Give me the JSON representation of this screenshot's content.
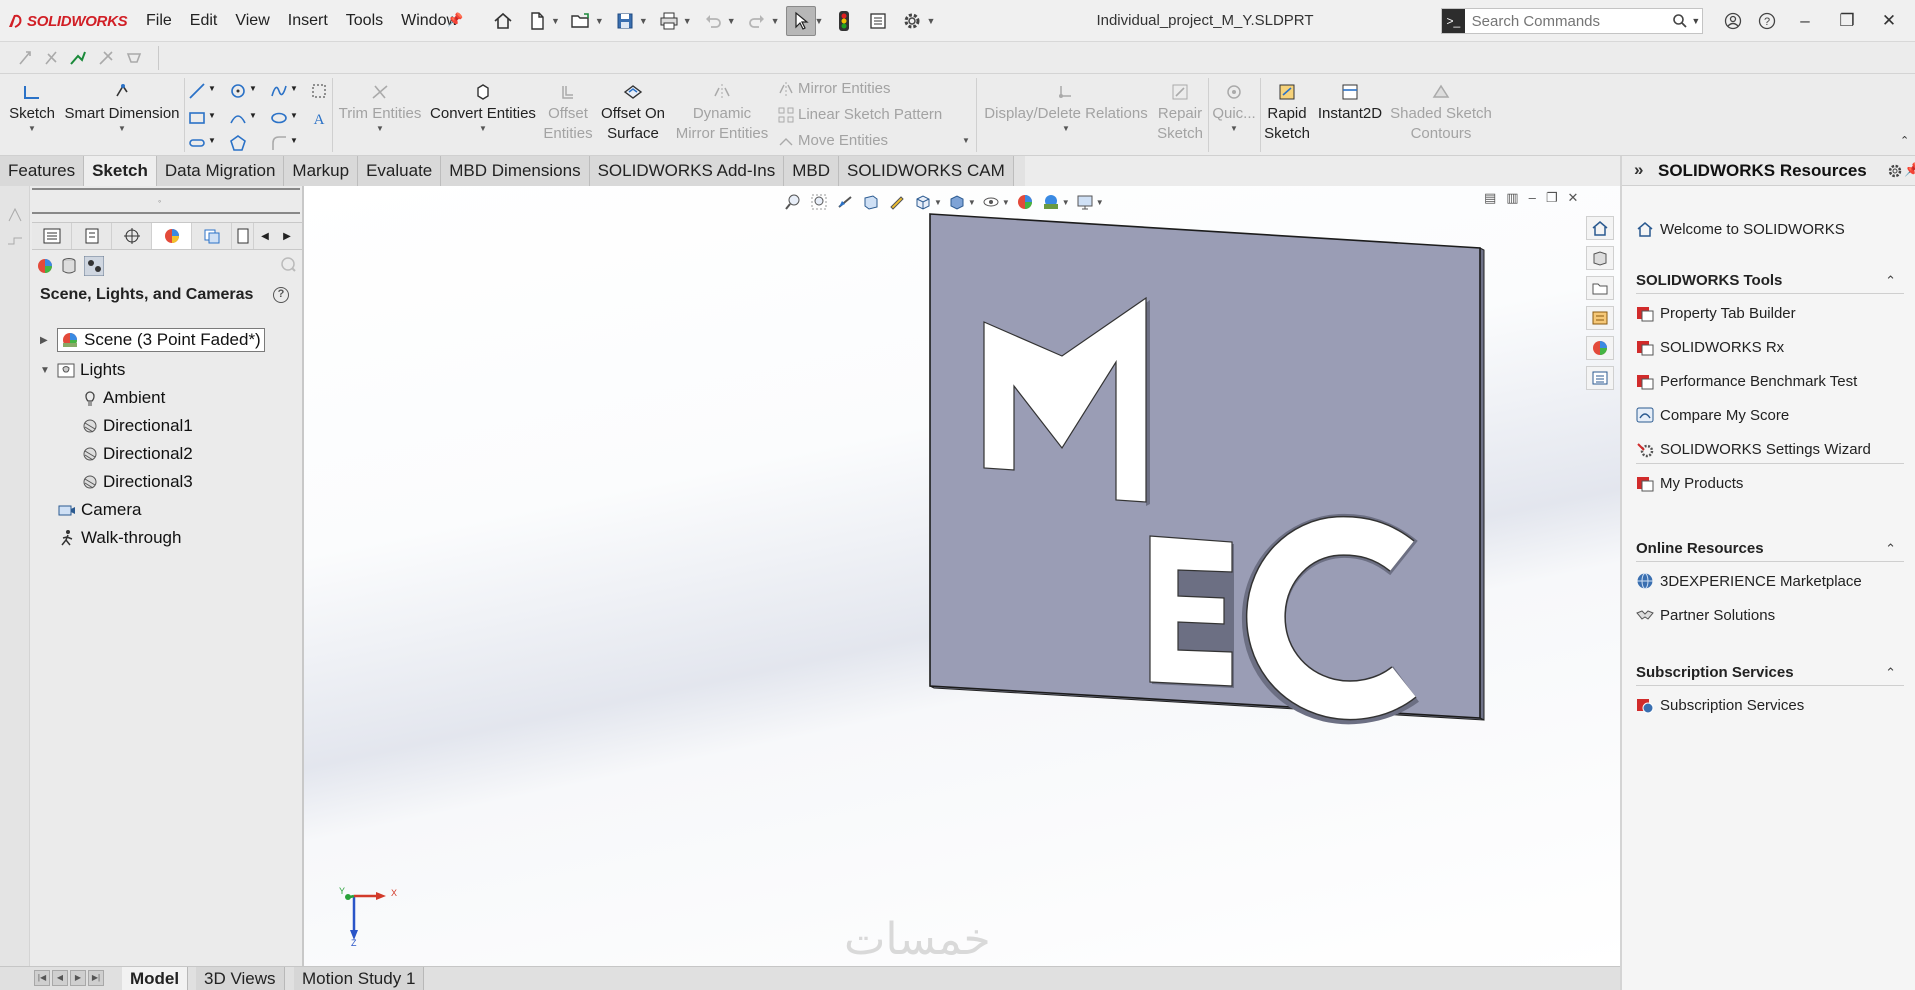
{
  "app": {
    "logo_text": "SOLIDWORKS",
    "doc_title": "Individual_project_M_Y.SLDPRT"
  },
  "menu": [
    "File",
    "Edit",
    "View",
    "Insert",
    "Tools",
    "Window"
  ],
  "search": {
    "placeholder": "Search Commands"
  },
  "commands": {
    "sketch": "Sketch",
    "smart_dimension": "Smart Dimension",
    "trim_entities": "Trim Entities",
    "convert_entities": "Convert Entities",
    "offset_entities_1": "Offset",
    "offset_entities_2": "Entities",
    "offset_on_surface_1": "Offset On",
    "offset_on_surface_2": "Surface",
    "dynamic_mirror_1": "Dynamic",
    "dynamic_mirror_2": "Mirror Entities",
    "mirror_entities": "Mirror Entities",
    "linear_sketch_pattern": "Linear Sketch Pattern",
    "move_entities": "Move Entities",
    "display_delete_relations": "Display/Delete Relations",
    "repair_sketch_1": "Repair",
    "repair_sketch_2": "Sketch",
    "quick_snaps": "Quic...",
    "rapid_sketch_1": "Rapid",
    "rapid_sketch_2": "Sketch",
    "instant2d": "Instant2D",
    "shaded_contours_1": "Shaded Sketch",
    "shaded_contours_2": "Contours"
  },
  "tabs": [
    "Features",
    "Sketch",
    "Data Migration",
    "Markup",
    "Evaluate",
    "MBD Dimensions",
    "SOLIDWORKS Add-Ins",
    "MBD",
    "SOLIDWORKS CAM"
  ],
  "active_tab": "Sketch",
  "left_panel": {
    "heading": "Scene, Lights, and Cameras",
    "help": "?",
    "tree": {
      "scene": "Scene (3 Point Faded*)",
      "lights": "Lights",
      "ambient": "Ambient",
      "dir1": "Directional1",
      "dir2": "Directional2",
      "dir3": "Directional3",
      "camera": "Camera",
      "walkthrough": "Walk-through"
    }
  },
  "model": {
    "letter_m": "M",
    "letter_e": "E",
    "letter_c": "C",
    "plate_color": "#9a9db5"
  },
  "triad": {
    "x": "X",
    "y": "Y",
    "z": "Z"
  },
  "watermark": "خمسات",
  "bottom_tabs": [
    "Model",
    "3D Views",
    "Motion Study 1"
  ],
  "right_pane": {
    "title": "SOLIDWORKS Resources",
    "welcome": "Welcome to SOLIDWORKS",
    "tools_header": "SOLIDWORKS Tools",
    "tools": [
      "Property Tab Builder",
      "SOLIDWORKS Rx",
      "Performance Benchmark Test",
      "Compare My Score",
      "SOLIDWORKS Settings Wizard",
      "My Products"
    ],
    "online_header": "Online Resources",
    "online": [
      "3DEXPERIENCE Marketplace",
      "Partner Solutions"
    ],
    "subs_header": "Subscription Services",
    "subs": [
      "Subscription Services"
    ]
  }
}
